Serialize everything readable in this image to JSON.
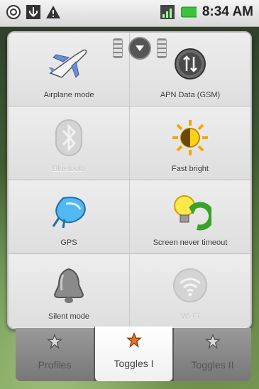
{
  "status_bar": {
    "time": "8:34 AM",
    "left_icons": [
      "gps-status-icon",
      "usb-icon",
      "warning-icon"
    ],
    "right_icons": [
      "signal-icon",
      "battery-icon"
    ]
  },
  "toggles": [
    {
      "label": "Airplane mode",
      "icon": "airplane-icon",
      "enabled": true
    },
    {
      "label": "APN Data (GSM)",
      "icon": "apn-data-icon",
      "enabled": true
    },
    {
      "label": "Bluetooth",
      "icon": "bluetooth-icon",
      "enabled": false
    },
    {
      "label": "Fast bright",
      "icon": "brightness-icon",
      "enabled": true
    },
    {
      "label": "GPS",
      "icon": "gps-satellite-icon",
      "enabled": true
    },
    {
      "label": "Screen never timeout",
      "icon": "bulb-refresh-icon",
      "enabled": true
    },
    {
      "label": "Silent mode",
      "icon": "bell-icon",
      "enabled": true
    },
    {
      "label": "Wi-Fi",
      "icon": "wifi-icon",
      "enabled": false
    }
  ],
  "tabs": [
    {
      "label": "Profiles",
      "icon": "star-icon",
      "active": false
    },
    {
      "label": "Toggles I",
      "icon": "star-icon",
      "active": true
    },
    {
      "label": "Toggles II",
      "icon": "star-icon",
      "active": false
    }
  ],
  "colors": {
    "panel": "#e8e8e8",
    "active_tab": "#ffffff",
    "inactive_tab": "#8a8a8a",
    "star_active": "#e8742a"
  }
}
